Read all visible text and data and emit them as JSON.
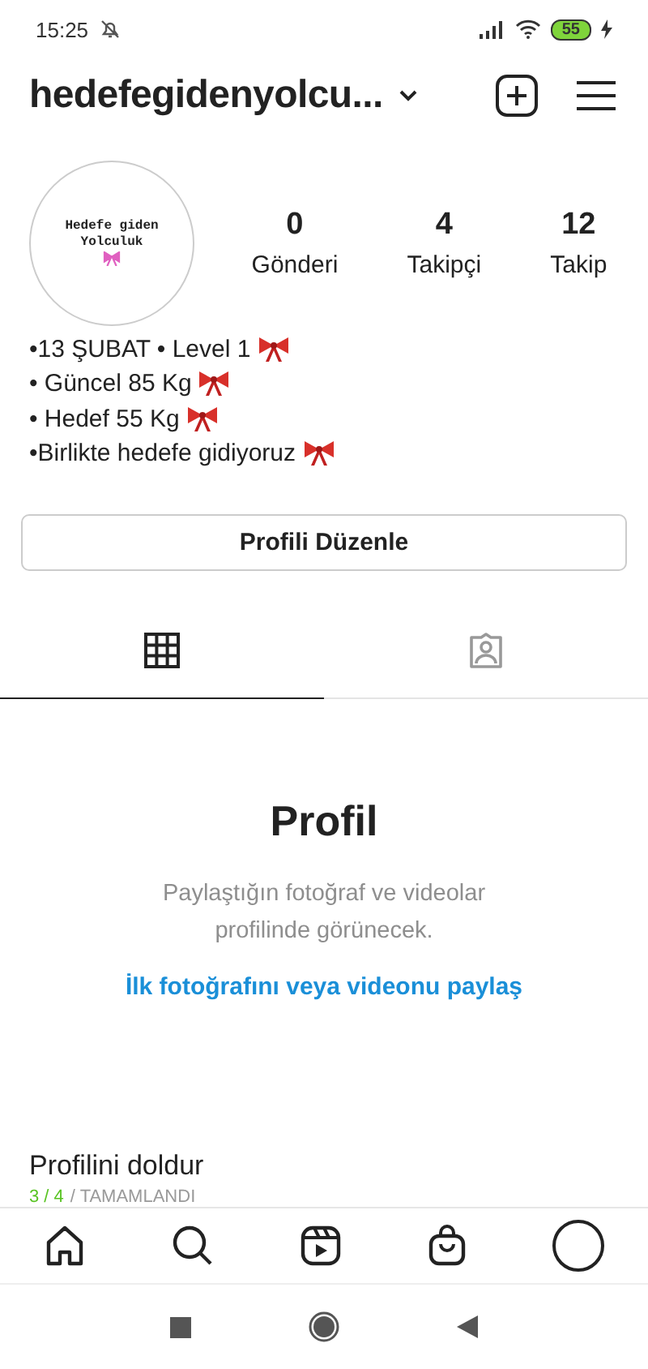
{
  "status_bar": {
    "time": "15:25",
    "battery": "55"
  },
  "header": {
    "username": "hedefegidenyolcu..."
  },
  "profile": {
    "avatar_text": "Hedefe giden Yolculuk",
    "stats": [
      {
        "value": "0",
        "label": "Gönderi"
      },
      {
        "value": "4",
        "label": "Takipçi"
      },
      {
        "value": "12",
        "label": "Takip"
      }
    ],
    "bio": [
      "•13 ŞUBAT • Level 1",
      "• Güncel 85 Kg",
      "• Hedef 55 Kg",
      "•Birlikte hedefe gidiyoruz"
    ]
  },
  "edit_button": "Profili Düzenle",
  "tabs": [
    {
      "kind": "grid",
      "selected": true
    },
    {
      "kind": "tagged",
      "selected": false
    }
  ],
  "empty_state": {
    "title": "Profil",
    "description": "Paylaştığın fotoğraf ve videolar profilinde görünecek.",
    "link": "İlk fotoğrafını veya videonu paylaş"
  },
  "complete_profile": {
    "title": "Profilini doldur",
    "progress": "3 / 4",
    "status": "/ TAMAMLANDI"
  }
}
